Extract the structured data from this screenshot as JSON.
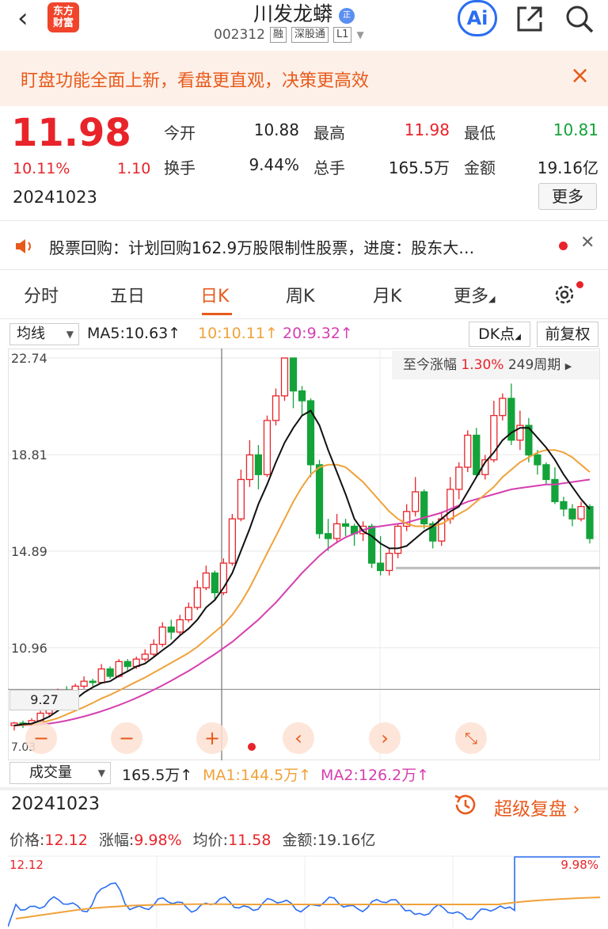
{
  "header": {
    "back_icon": "chevron-left-icon",
    "logo_line1": "东方",
    "logo_line2": "财富",
    "stock_name": "川发龙蟒",
    "name_badge": "正",
    "stock_code": "002312",
    "tags": [
      "融",
      "深股通",
      "L1"
    ],
    "ai_label": "Ai"
  },
  "banner": {
    "text": "盯盘功能全面上新，看盘更直观，决策更高效"
  },
  "quote": {
    "price": "11.98",
    "change_pct": "10.11%",
    "change_amt": "1.10",
    "date": "20241023",
    "open_label": "今开",
    "open": "10.88",
    "high_label": "最高",
    "high": "11.98",
    "low_label": "最低",
    "low": "10.81",
    "turnover_label": "换手",
    "turnover": "9.44%",
    "volume_label": "总手",
    "volume": "165.5万",
    "amount_label": "金额",
    "amount": "19.16亿",
    "more_label": "更多"
  },
  "notice": {
    "text": "股票回购：计划回购162.9万股限制性股票，进度：股东大…"
  },
  "tabs": [
    "分时",
    "五日",
    "日K",
    "周K",
    "月K",
    "更多"
  ],
  "active_tab": "日K",
  "ma_row": {
    "select_label": "均线",
    "ma5": "MA5:10.63↑",
    "ma10": "10:10.11↑",
    "ma20": "20:9.32↑",
    "dk_label": "DK点",
    "fq_label": "前复权"
  },
  "kchart": {
    "y_labels": [
      "22.74",
      "18.81",
      "14.89",
      "10.96"
    ],
    "range_label": "至今涨幅",
    "range_value": "1.30%",
    "range_period": "249周期",
    "crosshair_price": "9.27",
    "bottom_label": "7.03"
  },
  "volume_row": {
    "select_label": "成交量",
    "value": "165.5万↑",
    "ma1": "MA1:144.5万↑",
    "ma2": "MA2:126.2万↑"
  },
  "footer": {
    "date": "20241023",
    "replay_label": "超级复盘",
    "price_label": "价格:",
    "price_value": "12.12",
    "chg_label": "涨幅:",
    "chg_value": "9.98%",
    "avg_label": "均价:",
    "avg_value": "11.58",
    "amt_label": "金额:",
    "amt_value": "19.16亿"
  },
  "mini_chart": {
    "left_label": "12.12",
    "right_label": "9.98%"
  },
  "colors": {
    "up": "#e8242a",
    "down": "#13a33a",
    "accent": "#e85a1c",
    "ma10": "#f0a23a",
    "ma20": "#d63fb0"
  },
  "chart_data": {
    "type": "candlestick",
    "y_ticks": [
      22.74,
      18.81,
      14.89,
      10.96
    ],
    "ylim": [
      7.03,
      22.74
    ],
    "candles": [
      [
        7.8,
        7.9,
        7.6,
        7.95
      ],
      [
        7.9,
        7.85,
        7.7,
        8.0
      ],
      [
        7.85,
        8.0,
        7.8,
        8.1
      ],
      [
        8.0,
        8.3,
        7.95,
        8.4
      ],
      [
        8.3,
        8.7,
        8.2,
        8.8
      ],
      [
        8.7,
        9.2,
        8.6,
        9.3
      ],
      [
        9.2,
        9.0,
        8.8,
        9.4
      ],
      [
        9.0,
        9.4,
        8.9,
        9.5
      ],
      [
        9.4,
        9.6,
        9.3,
        9.8
      ],
      [
        9.6,
        9.55,
        9.4,
        9.7
      ],
      [
        9.55,
        10.1,
        9.5,
        10.3
      ],
      [
        10.1,
        9.8,
        9.7,
        10.2
      ],
      [
        9.8,
        10.4,
        9.75,
        10.5
      ],
      [
        10.4,
        10.2,
        10.0,
        10.5
      ],
      [
        10.2,
        10.5,
        10.1,
        10.6
      ],
      [
        10.5,
        10.7,
        10.4,
        10.9
      ],
      [
        10.7,
        11.1,
        10.6,
        11.3
      ],
      [
        11.1,
        11.8,
        11.0,
        12.0
      ],
      [
        11.8,
        11.6,
        11.3,
        12.1
      ],
      [
        11.6,
        12.1,
        11.5,
        12.3
      ],
      [
        12.1,
        12.6,
        12.0,
        12.8
      ],
      [
        12.6,
        13.4,
        12.5,
        13.7
      ],
      [
        13.4,
        14.0,
        13.3,
        14.3
      ],
      [
        14.0,
        13.2,
        12.9,
        14.1
      ],
      [
        13.2,
        14.4,
        13.1,
        14.6
      ],
      [
        14.4,
        16.2,
        14.3,
        16.4
      ],
      [
        16.2,
        17.8,
        16.1,
        18.2
      ],
      [
        17.8,
        18.8,
        17.5,
        19.4
      ],
      [
        18.8,
        18.0,
        17.4,
        19.2
      ],
      [
        18.0,
        20.2,
        17.9,
        20.4
      ],
      [
        20.2,
        21.2,
        20.0,
        21.5
      ],
      [
        21.2,
        22.74,
        21.0,
        22.74
      ],
      [
        22.74,
        21.4,
        20.7,
        22.74
      ],
      [
        21.4,
        21.0,
        20.4,
        21.6
      ],
      [
        21.0,
        18.4,
        17.9,
        21.1
      ],
      [
        18.4,
        15.6,
        15.4,
        18.6
      ],
      [
        15.6,
        15.4,
        14.9,
        16.2
      ],
      [
        15.4,
        16.0,
        15.2,
        16.4
      ],
      [
        16.0,
        15.9,
        15.5,
        16.2
      ],
      [
        15.9,
        15.6,
        15.1,
        16.0
      ],
      [
        15.6,
        15.9,
        15.3,
        16.1
      ],
      [
        15.9,
        14.4,
        14.2,
        16.0
      ],
      [
        14.4,
        14.1,
        13.9,
        15.5
      ],
      [
        14.1,
        14.8,
        13.9,
        15.0
      ],
      [
        14.8,
        15.9,
        14.6,
        16.0
      ],
      [
        15.9,
        16.5,
        15.7,
        16.8
      ],
      [
        16.5,
        17.3,
        16.3,
        17.9
      ],
      [
        17.3,
        16.0,
        15.8,
        17.4
      ],
      [
        16.0,
        15.3,
        15.0,
        16.1
      ],
      [
        15.3,
        16.2,
        15.1,
        16.5
      ],
      [
        16.2,
        17.4,
        16.0,
        17.9
      ],
      [
        17.4,
        18.3,
        17.0,
        18.5
      ],
      [
        18.3,
        19.6,
        18.1,
        19.8
      ],
      [
        19.6,
        18.0,
        17.9,
        19.9
      ],
      [
        18.0,
        18.6,
        17.8,
        18.8
      ],
      [
        18.6,
        20.4,
        18.5,
        21.0
      ],
      [
        20.4,
        21.1,
        20.2,
        21.3
      ],
      [
        21.1,
        19.4,
        19.2,
        21.7
      ],
      [
        19.4,
        20.0,
        19.0,
        20.6
      ],
      [
        20.0,
        18.8,
        18.5,
        20.3
      ],
      [
        18.8,
        18.4,
        18.0,
        19.0
      ],
      [
        18.4,
        17.8,
        17.6,
        18.5
      ],
      [
        17.8,
        16.9,
        16.8,
        18.3
      ],
      [
        16.9,
        16.6,
        16.3,
        17.1
      ],
      [
        16.6,
        16.2,
        15.9,
        16.8
      ],
      [
        16.2,
        16.7,
        16.1,
        16.9
      ],
      [
        16.7,
        15.4,
        15.2,
        16.8
      ]
    ],
    "ma5": [
      7.8,
      7.85,
      7.88,
      8.0,
      8.16,
      8.4,
      8.64,
      8.86,
      9.14,
      9.35,
      9.53,
      9.6,
      9.82,
      10.0,
      10.2,
      10.32,
      10.58,
      10.86,
      11.12,
      11.46,
      11.74,
      12.1,
      12.6,
      12.9,
      13.4,
      14.0,
      14.9,
      15.8,
      16.8,
      17.6,
      18.5,
      19.3,
      19.9,
      20.4,
      20.6,
      20.0,
      19.0,
      18.1,
      17.2,
      16.2,
      15.7,
      15.5,
      15.2,
      15.0,
      15.0,
      15.1,
      15.4,
      15.7,
      15.9,
      16.2,
      16.5,
      16.7,
      17.3,
      17.9,
      18.5,
      18.9,
      19.4,
      19.7,
      19.9,
      19.9,
      19.5,
      19.1,
      18.6,
      18.0,
      17.5,
      17.0,
      16.6
    ],
    "ma10": [
      7.8,
      7.82,
      7.85,
      7.9,
      8.0,
      8.1,
      8.25,
      8.4,
      8.55,
      8.72,
      8.9,
      9.05,
      9.22,
      9.4,
      9.58,
      9.75,
      9.95,
      10.15,
      10.35,
      10.55,
      10.75,
      11.0,
      11.3,
      11.6,
      11.9,
      12.3,
      12.8,
      13.4,
      14.1,
      14.8,
      15.5,
      16.2,
      16.9,
      17.5,
      18.0,
      18.3,
      18.4,
      18.4,
      18.3,
      18.0,
      17.7,
      17.3,
      16.9,
      16.5,
      16.2,
      16.0,
      15.9,
      15.9,
      15.9,
      16.0,
      16.2,
      16.4,
      16.6,
      16.9,
      17.2,
      17.5,
      17.9,
      18.2,
      18.5,
      18.7,
      18.9,
      19.0,
      19.0,
      18.9,
      18.7,
      18.4,
      18.1
    ],
    "ma20": [
      7.8,
      7.81,
      7.83,
      7.85,
      7.88,
      7.93,
      8.0,
      8.08,
      8.17,
      8.27,
      8.38,
      8.5,
      8.63,
      8.77,
      8.92,
      9.08,
      9.25,
      9.43,
      9.62,
      9.82,
      10.02,
      10.24,
      10.47,
      10.7,
      10.95,
      11.2,
      11.5,
      11.8,
      12.1,
      12.45,
      12.8,
      13.2,
      13.6,
      14.0,
      14.35,
      14.7,
      15.0,
      15.25,
      15.45,
      15.6,
      15.75,
      15.85,
      15.9,
      15.95,
      16.0,
      16.05,
      16.15,
      16.25,
      16.35,
      16.45,
      16.6,
      16.75,
      16.9,
      17.0,
      17.1,
      17.2,
      17.3,
      17.4,
      17.45,
      17.5,
      17.55,
      17.6,
      17.6,
      17.65,
      17.7,
      17.75,
      17.8
    ]
  }
}
